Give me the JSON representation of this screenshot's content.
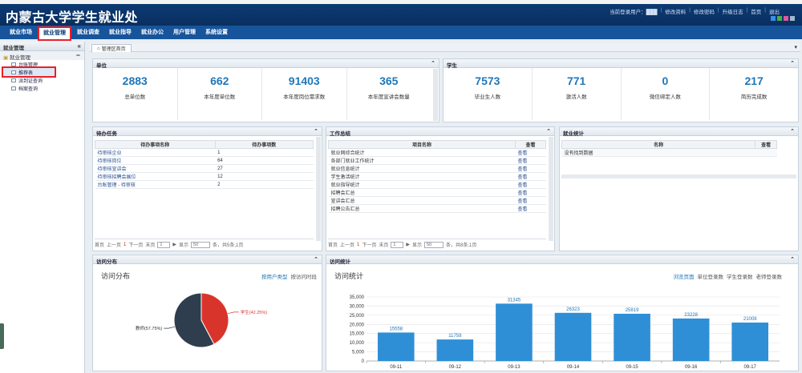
{
  "header": {
    "title": "内蒙古大学学生就业处",
    "links": [
      "当前登录用户：",
      "修改资料",
      "修改密码",
      "升级日志",
      "首页",
      "退出"
    ],
    "user_name": "███"
  },
  "nav": {
    "items": [
      "就业市场",
      "就业管理",
      "就业调查",
      "就业指导",
      "就业办公",
      "用户管理",
      "系统设置"
    ],
    "active": "就业管理"
  },
  "sidebar": {
    "title": "就业管理",
    "group": "就业管理",
    "items": [
      "台账管理",
      "推荐表",
      "派到证查询",
      "档案查询"
    ],
    "selected": "推荐表"
  },
  "tab": {
    "label": "管理区首页"
  },
  "unit_panel": {
    "title": "单位",
    "stats": [
      {
        "value": "2883",
        "label": "总单位数"
      },
      {
        "value": "662",
        "label": "本年度单位数"
      },
      {
        "value": "91403",
        "label": "本年度岗位需求数"
      },
      {
        "value": "365",
        "label": "本年度宣讲会数量"
      }
    ]
  },
  "student_panel": {
    "title": "学生",
    "stats": [
      {
        "value": "7573",
        "label": "毕业生人数"
      },
      {
        "value": "771",
        "label": "激活人数"
      },
      {
        "value": "0",
        "label": "微信绑定人数"
      },
      {
        "value": "217",
        "label": "简历完成数"
      }
    ]
  },
  "todo_panel": {
    "title": "待办任务",
    "columns": [
      "待办事项名称",
      "待办事项数"
    ],
    "rows": [
      [
        "待审核企业",
        "1"
      ],
      [
        "待审核岗位",
        "64"
      ],
      [
        "待审核宣讲会",
        "27"
      ],
      [
        "待审核招聘会展位",
        "12"
      ],
      [
        "台账管理 - 待审核",
        "2"
      ]
    ],
    "pager": {
      "first": "首页",
      "prev": "上一页",
      "page": "1",
      "next": "下一页",
      "last": "末页",
      "input": "1",
      "show": "显示",
      "size": "50",
      "summary": "条，共5条,1页"
    }
  },
  "work_panel": {
    "title": "工作总结",
    "columns": [
      "项目名称",
      "查看"
    ],
    "rows": [
      [
        "就业网综合统计",
        "查看"
      ],
      [
        "各部门就业工作统计",
        "查看"
      ],
      [
        "就业信息统计",
        "查看"
      ],
      [
        "学生激活统计",
        "查看"
      ],
      [
        "就业指导统计",
        "查看"
      ],
      [
        "招聘会汇总",
        "查看"
      ],
      [
        "宣讲会汇总",
        "查看"
      ],
      [
        "招聘公告汇总",
        "查看"
      ]
    ],
    "pager": {
      "first": "首页",
      "prev": "上一页",
      "page": "1",
      "next": "下一页",
      "last": "末页",
      "input": "1",
      "show": "显示",
      "size": "50",
      "summary": "条，共8条,1页"
    }
  },
  "emp_panel": {
    "title": "就业统计",
    "columns": [
      "名称",
      "查看"
    ],
    "empty": "没有找到数据"
  },
  "visit_dist": {
    "title": "访问分布",
    "chart_title": "访问分布",
    "links": [
      "按用户类型",
      "按访问时段"
    ],
    "active_link": "按用户类型"
  },
  "visit_stats": {
    "title": "访问统计",
    "chart_title": "访问统计",
    "links": [
      "浏览页面",
      "单位登录数",
      "学生登录数",
      "老师登录数"
    ],
    "active_link": "浏览页面"
  },
  "chart_data": [
    {
      "type": "pie",
      "title": "访问分布",
      "categories": [
        "学生",
        "教师"
      ],
      "labels": [
        "学生(42.25%)",
        "教师(57.75%)"
      ],
      "values": [
        42.25,
        57.75
      ],
      "colors": {
        "学生": "#d9342b",
        "教师": "#2e3e4e"
      }
    },
    {
      "type": "bar",
      "title": "访问统计",
      "categories": [
        "09-11",
        "09-12",
        "09-13",
        "09-14",
        "09-15",
        "09-16",
        "09-17"
      ],
      "values": [
        15558,
        11759,
        31345,
        26323,
        25819,
        23228,
        21008
      ],
      "yticks": [
        "0",
        "5,000",
        "10,000",
        "15,000",
        "20,000",
        "25,000",
        "30,000",
        "35,000"
      ],
      "ylim": [
        0,
        35000
      ],
      "color": "#2f8fd6"
    }
  ]
}
